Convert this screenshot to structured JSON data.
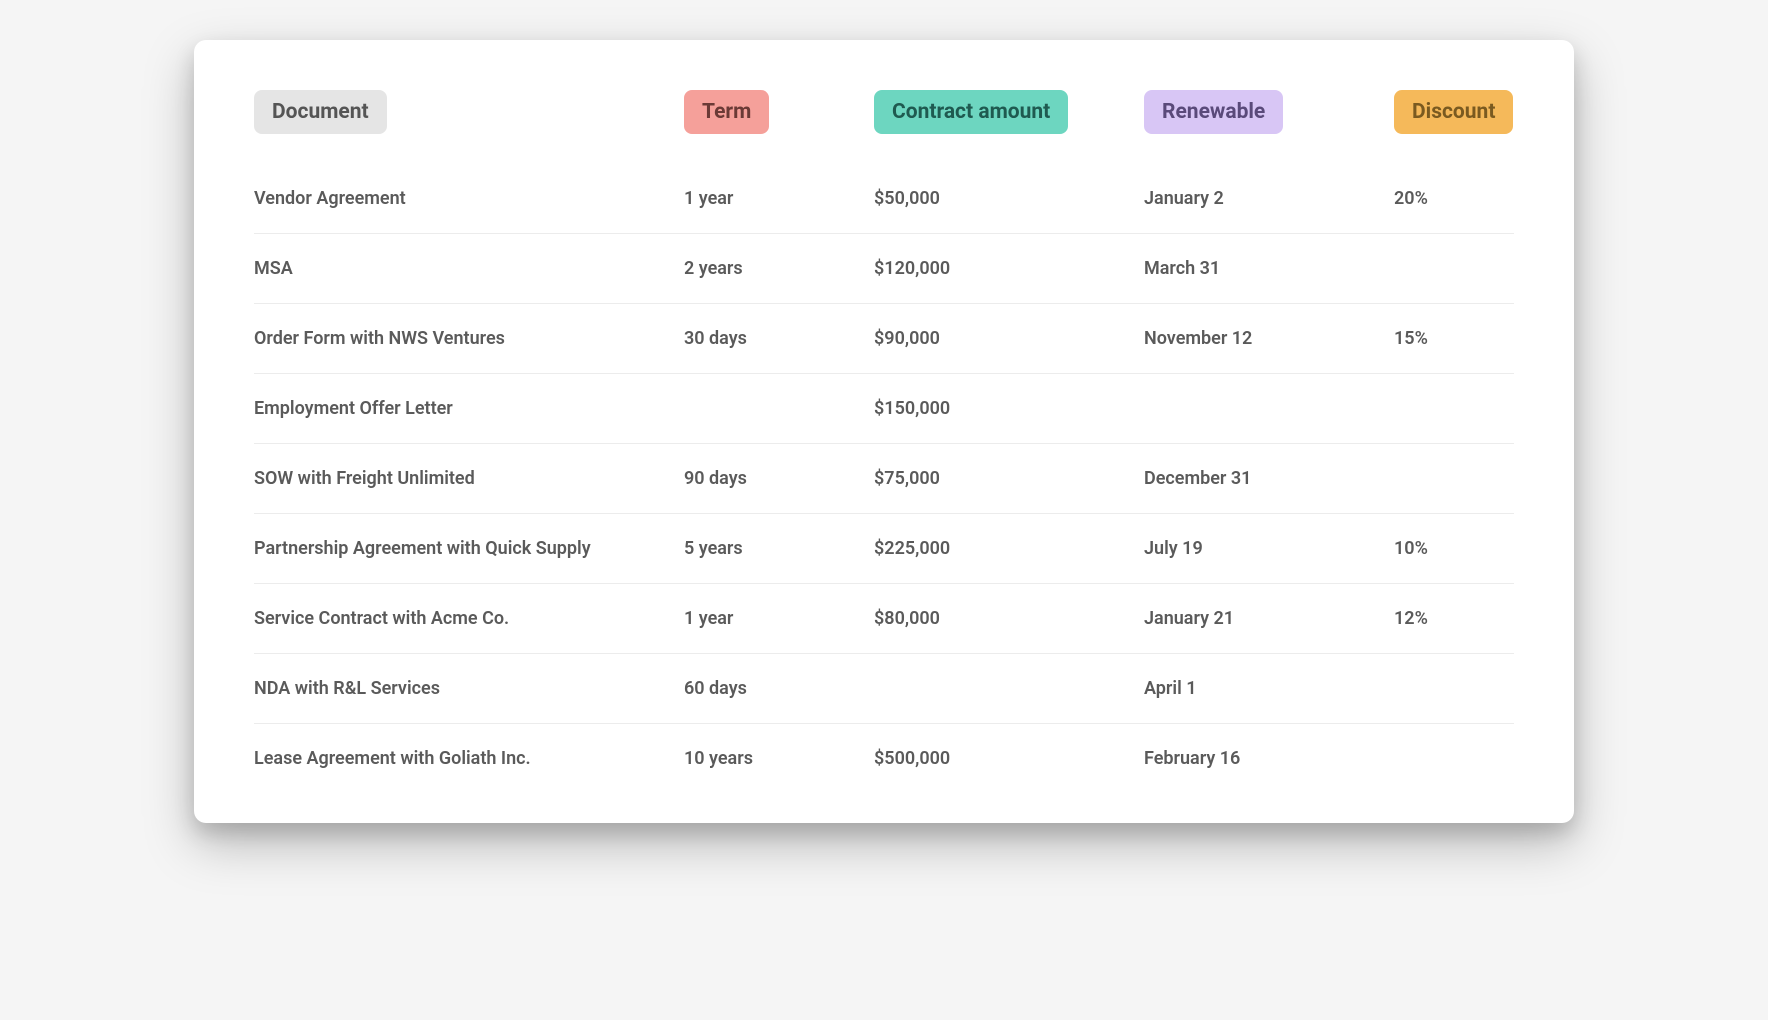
{
  "headers": {
    "document": "Document",
    "term": "Term",
    "contract_amount": "Contract amount",
    "renewable": "Renewable",
    "discount": "Discount"
  },
  "rows": [
    {
      "document": "Vendor Agreement",
      "term": "1 year",
      "contract_amount": "$50,000",
      "renewable": "January 2",
      "discount": "20%"
    },
    {
      "document": "MSA",
      "term": "2 years",
      "contract_amount": "$120,000",
      "renewable": "March 31",
      "discount": ""
    },
    {
      "document": "Order Form with NWS Ventures",
      "term": "30 days",
      "contract_amount": "$90,000",
      "renewable": "November 12",
      "discount": "15%"
    },
    {
      "document": "Employment Offer Letter",
      "term": "",
      "contract_amount": "$150,000",
      "renewable": "",
      "discount": ""
    },
    {
      "document": "SOW with Freight Unlimited",
      "term": "90 days",
      "contract_amount": "$75,000",
      "renewable": "December 31",
      "discount": ""
    },
    {
      "document": "Partnership Agreement with Quick Supply",
      "term": "5 years",
      "contract_amount": "$225,000",
      "renewable": "July 19",
      "discount": "10%"
    },
    {
      "document": "Service Contract with Acme Co.",
      "term": "1 year",
      "contract_amount": "$80,000",
      "renewable": "January 21",
      "discount": "12%"
    },
    {
      "document": "NDA with R&L Services",
      "term": "60 days",
      "contract_amount": "",
      "renewable": "April 1",
      "discount": ""
    },
    {
      "document": "Lease Agreement with Goliath Inc.",
      "term": "10 years",
      "contract_amount": "$500,000",
      "renewable": "February 16",
      "discount": ""
    }
  ]
}
